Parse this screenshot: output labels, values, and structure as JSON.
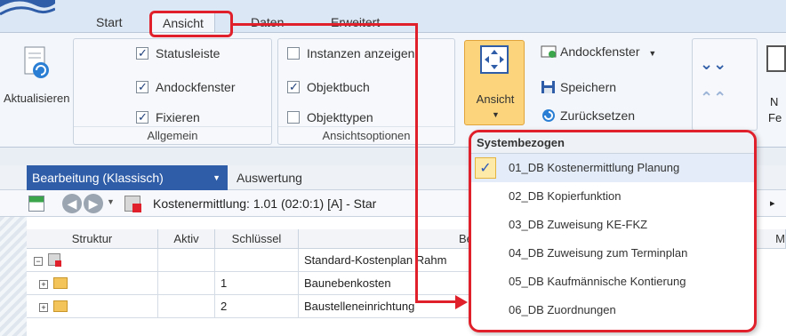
{
  "tabs": [
    {
      "label": "Start"
    },
    {
      "label": "Ansicht"
    },
    {
      "label": "Daten"
    },
    {
      "label": "Erweitert"
    }
  ],
  "ribbon": {
    "refresh_label": "Aktualisieren",
    "group_allgemein": {
      "label": "Allgemein",
      "items": [
        {
          "label": "Statusleiste",
          "checked": true
        },
        {
          "label": "Andockfenster",
          "checked": true
        },
        {
          "label": "Fixieren",
          "checked": true
        }
      ]
    },
    "group_ansichtsoptionen": {
      "label": "Ansichtsoptionen",
      "items": [
        {
          "label": "Instanzen anzeigen",
          "checked": false
        },
        {
          "label": "Objektbuch",
          "checked": true
        },
        {
          "label": "Objekttypen",
          "checked": false
        }
      ]
    },
    "ansicht_button_label": "Ansicht",
    "commands": [
      {
        "label": "Andockfenster",
        "icon": "window-dock-icon"
      },
      {
        "label": "Speichern",
        "icon": "floppy-disk-icon"
      },
      {
        "label": "Zurücksetzen",
        "icon": "reset-icon"
      }
    ],
    "partial_labels": {
      "top": "N",
      "bottom": "Fe"
    }
  },
  "toolbar": {
    "active_tab": "Bearbeitung (Klassisch)",
    "second_tab": "Auswertung",
    "record_label": "Kostenermittlung: 1.01 (02:0:1) [A]  - Star",
    "more_glyph": "▸"
  },
  "table": {
    "columns": [
      "Struktur",
      "Aktiv",
      "Schlüssel",
      "Bezeic",
      "M"
    ],
    "rows": [
      {
        "key": "",
        "desc": "Standard-Kostenplan Rahm"
      },
      {
        "key": "1",
        "desc": "Baunebenkosten"
      },
      {
        "key": "2",
        "desc": "Baustelleneinrichtung"
      }
    ]
  },
  "dropdown": {
    "header": "Systembezogen",
    "items": [
      {
        "label": "01_DB Kostenermittlung Planung",
        "selected": true
      },
      {
        "label": "02_DB Kopierfunktion",
        "selected": false
      },
      {
        "label": "03_DB Zuweisung KE-FKZ",
        "selected": false
      },
      {
        "label": "04_DB Zuweisung zum Terminplan",
        "selected": false
      },
      {
        "label": "05_DB Kaufmännische Kontierung",
        "selected": false
      },
      {
        "label": "06_DB Zuordnungen",
        "selected": false
      }
    ],
    "check_glyph": "✓"
  },
  "colors": {
    "accent_blue": "#2f5da8",
    "highlight_red": "#e0202a",
    "ribbon_bg": "#f3f6fa"
  }
}
